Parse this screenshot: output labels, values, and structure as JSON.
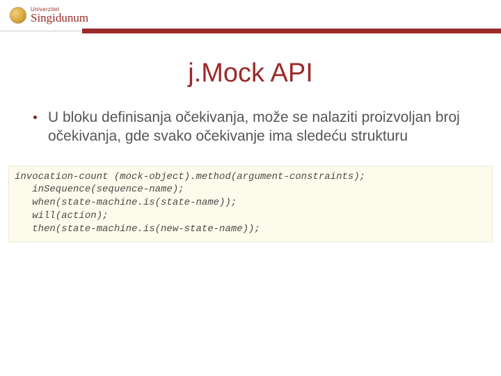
{
  "header": {
    "logo_sub": "Univerzitet",
    "logo_main": "Singidunum"
  },
  "title": "j.Mock API",
  "bullet": {
    "text": "U bloku definisanja očekivanja, može se nalaziti proizvoljan broj očekivanja, gde svako očekivanje ima sledeću strukturu"
  },
  "code": {
    "line1": "invocation-count (mock-object).method(argument-constraints);",
    "line2": "   inSequence(sequence-name);",
    "line3": "   when(state-machine.is(state-name));",
    "line4": "   will(action);",
    "line5": "   then(state-machine.is(new-state-name));"
  }
}
